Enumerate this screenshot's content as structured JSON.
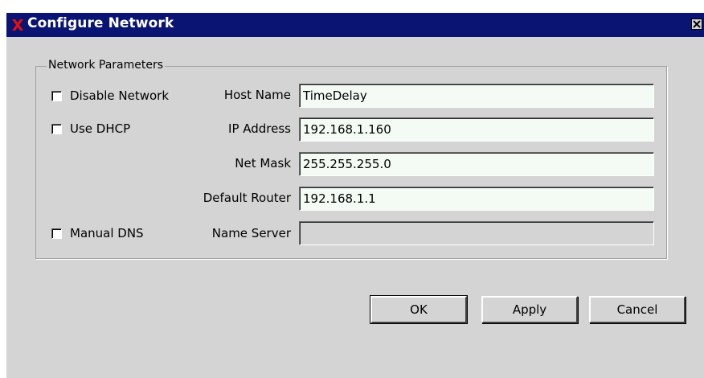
{
  "window": {
    "title": "Configure Network",
    "title_icon": "x-logo-icon",
    "close_icon": "close-icon"
  },
  "group": {
    "title": "Network Parameters"
  },
  "checkboxes": {
    "disable_network": {
      "label": "Disable Network",
      "checked": false
    },
    "use_dhcp": {
      "label": "Use DHCP",
      "checked": false
    },
    "manual_dns": {
      "label": "Manual DNS",
      "checked": false
    }
  },
  "fields": {
    "host_name": {
      "label": "Host Name",
      "value": "TimeDelay"
    },
    "ip_address": {
      "label": "IP Address",
      "value": "192.168.1.160"
    },
    "net_mask": {
      "label": "Net Mask",
      "value": "255.255.255.0"
    },
    "default_router": {
      "label": "Default Router",
      "value": "192.168.1.1"
    },
    "name_server": {
      "label": "Name Server",
      "value": "",
      "disabled": true
    }
  },
  "buttons": {
    "ok": "OK",
    "apply": "Apply",
    "cancel": "Cancel"
  },
  "colors": {
    "titlebar": "#0a1472",
    "window_bg": "#d4d4d4",
    "input_bg": "#f4fbf4",
    "logo_red": "#e01010"
  }
}
